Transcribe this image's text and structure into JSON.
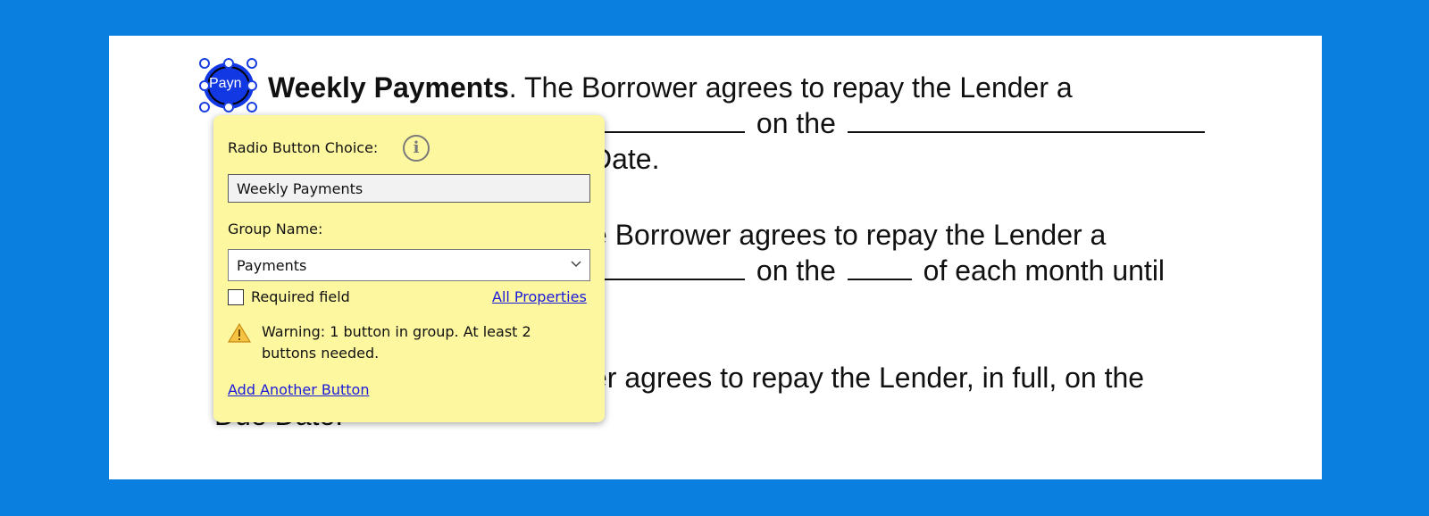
{
  "document": {
    "para1": {
      "line1_bold": "Weekly Payments",
      "line1_rest": ". The Borrower agrees to repay the Lender a",
      "line2_mid": "on the",
      "line3_end": "Date."
    },
    "para2": {
      "line1_rest": "e Borrower agrees to repay the Lender a",
      "line2_mid": "on the",
      "line2_end": "of each month until"
    },
    "para3": {
      "line1_rest": "er agrees to repay the Lender, in full, on the",
      "line2": "Due Date."
    },
    "radio_field_label": "Payn"
  },
  "popup": {
    "choice_label": "Radio Button Choice:",
    "choice_value": "Weekly Payments",
    "group_label": "Group Name:",
    "group_value": "Payments",
    "required_label": "Required field",
    "all_properties_link": "All Properties",
    "warning_text": "Warning: 1 button in group. At least 2 buttons needed.",
    "add_button_link": "Add Another Button"
  },
  "icons": {
    "info": "info-icon",
    "warning": "warning-icon",
    "chevron": "chevron-down-icon"
  },
  "colors": {
    "background": "#0a7fe0",
    "popup_bg": "#fdf7a0",
    "field_selection": "#1238e4",
    "link": "#1a1adb"
  }
}
